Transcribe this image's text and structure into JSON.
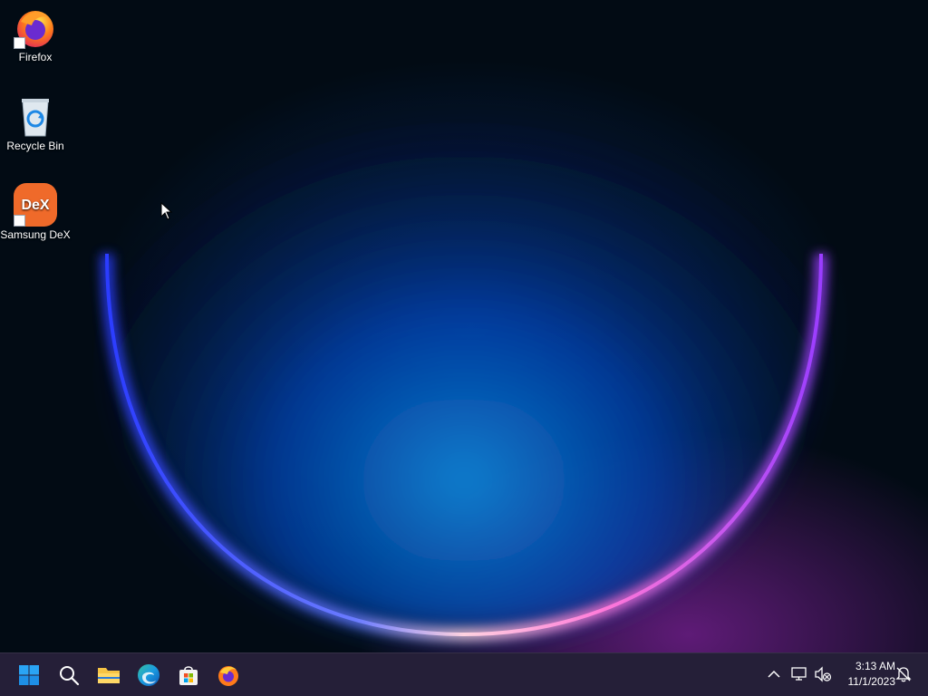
{
  "desktop": {
    "icons": [
      {
        "label": "Firefox",
        "icon": "firefox-icon",
        "shortcut": true
      },
      {
        "label": "Recycle Bin",
        "icon": "recycle-bin-icon",
        "shortcut": false
      },
      {
        "label": "Samsung DeX",
        "icon": "samsung-dex-icon",
        "shortcut": true,
        "badge_text": "DeX"
      }
    ]
  },
  "taskbar": {
    "pinned": [
      "start-icon",
      "search-icon",
      "file-explorer-icon",
      "edge-icon",
      "microsoft-store-icon",
      "firefox-icon"
    ],
    "tray": [
      "chevron-up-icon",
      "network-icon",
      "volume-muted-icon",
      "notification-icon"
    ],
    "clock": {
      "time": "3:13 AM",
      "date": "11/1/2023"
    }
  },
  "colors": {
    "taskbar_bg": "#1c1630",
    "desktop_bg": "#020b14",
    "accent_blue": "#0a7bd8",
    "ring_violet": "#b44dff",
    "dex_orange": "#ef6a2a"
  }
}
